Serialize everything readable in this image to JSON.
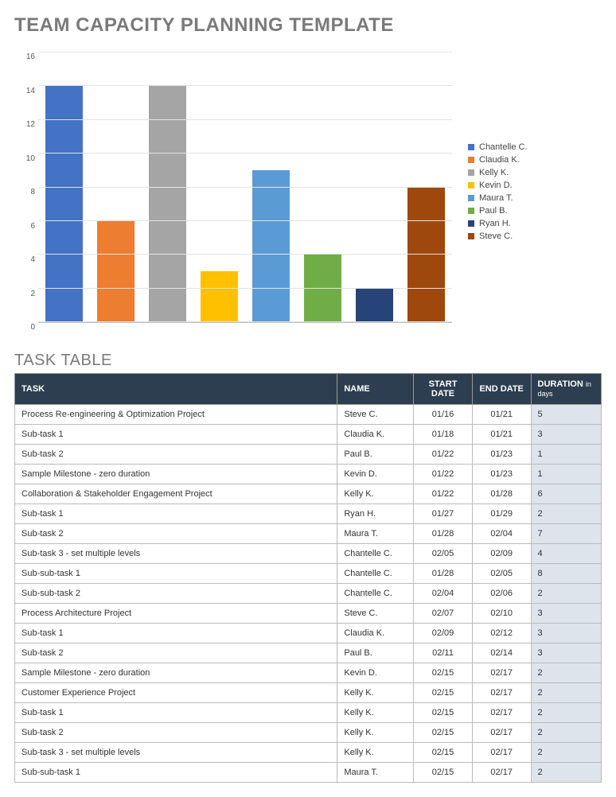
{
  "title": "TEAM CAPACITY PLANNING TEMPLATE",
  "chart_data": {
    "type": "bar",
    "ylim": [
      0,
      16
    ],
    "yticks": [
      0,
      2,
      4,
      6,
      8,
      10,
      12,
      14,
      16
    ],
    "series": [
      {
        "name": "Chantelle C.",
        "value": 14,
        "color": "#4472c4"
      },
      {
        "name": "Claudia K.",
        "value": 6,
        "color": "#ed7d31"
      },
      {
        "name": "Kelly K.",
        "value": 14,
        "color": "#a5a5a5"
      },
      {
        "name": "Kevin D.",
        "value": 3,
        "color": "#ffc000"
      },
      {
        "name": "Maura T.",
        "value": 9,
        "color": "#5b9bd5"
      },
      {
        "name": "Paul B.",
        "value": 4,
        "color": "#70ad47"
      },
      {
        "name": "Ryan H.",
        "value": 2,
        "color": "#264478"
      },
      {
        "name": "Steve C.",
        "value": 8,
        "color": "#9e480e"
      }
    ]
  },
  "table": {
    "title": "TASK TABLE",
    "columns": {
      "task": "TASK",
      "name": "NAME",
      "start": "START DATE",
      "end": "END DATE",
      "duration": "DURATION",
      "duration_unit": "in days"
    },
    "rows": [
      {
        "task": "Process Re-engineering & Optimization Project",
        "name": "Steve C.",
        "start": "01/16",
        "end": "01/21",
        "duration": "5"
      },
      {
        "task": "Sub-task 1",
        "name": "Claudia K.",
        "start": "01/18",
        "end": "01/21",
        "duration": "3"
      },
      {
        "task": "Sub-task 2",
        "name": "Paul B.",
        "start": "01/22",
        "end": "01/23",
        "duration": "1"
      },
      {
        "task": "Sample Milestone - zero duration",
        "name": "Kevin D.",
        "start": "01/22",
        "end": "01/23",
        "duration": "1"
      },
      {
        "task": "Collaboration & Stakeholder Engagement Project",
        "name": "Kelly K.",
        "start": "01/22",
        "end": "01/28",
        "duration": "6"
      },
      {
        "task": "Sub-task 1",
        "name": "Ryan H.",
        "start": "01/27",
        "end": "01/29",
        "duration": "2"
      },
      {
        "task": "Sub-task 2",
        "name": "Maura T.",
        "start": "01/28",
        "end": "02/04",
        "duration": "7"
      },
      {
        "task": "Sub-task 3 - set multiple levels",
        "name": "Chantelle C.",
        "start": "02/05",
        "end": "02/09",
        "duration": "4"
      },
      {
        "task": "Sub-sub-task 1",
        "name": "Chantelle C.",
        "start": "01/28",
        "end": "02/05",
        "duration": "8"
      },
      {
        "task": "Sub-sub-task 2",
        "name": "Chantelle C.",
        "start": "02/04",
        "end": "02/06",
        "duration": "2"
      },
      {
        "task": "Process Architecture Project",
        "name": "Steve C.",
        "start": "02/07",
        "end": "02/10",
        "duration": "3"
      },
      {
        "task": "Sub-task 1",
        "name": "Claudia K.",
        "start": "02/09",
        "end": "02/12",
        "duration": "3"
      },
      {
        "task": "Sub-task 2",
        "name": "Paul B.",
        "start": "02/11",
        "end": "02/14",
        "duration": "3"
      },
      {
        "task": "Sample Milestone - zero duration",
        "name": "Kevin D.",
        "start": "02/15",
        "end": "02/17",
        "duration": "2"
      },
      {
        "task": "Customer Experience Project",
        "name": "Kelly K.",
        "start": "02/15",
        "end": "02/17",
        "duration": "2"
      },
      {
        "task": "Sub-task 1",
        "name": "Kelly K.",
        "start": "02/15",
        "end": "02/17",
        "duration": "2"
      },
      {
        "task": "Sub-task 2",
        "name": "Kelly K.",
        "start": "02/15",
        "end": "02/17",
        "duration": "2"
      },
      {
        "task": "Sub-task 3 - set multiple levels",
        "name": "Kelly K.",
        "start": "02/15",
        "end": "02/17",
        "duration": "2"
      },
      {
        "task": "Sub-sub-task 1",
        "name": "Maura T.",
        "start": "02/15",
        "end": "02/17",
        "duration": "2"
      }
    ]
  }
}
